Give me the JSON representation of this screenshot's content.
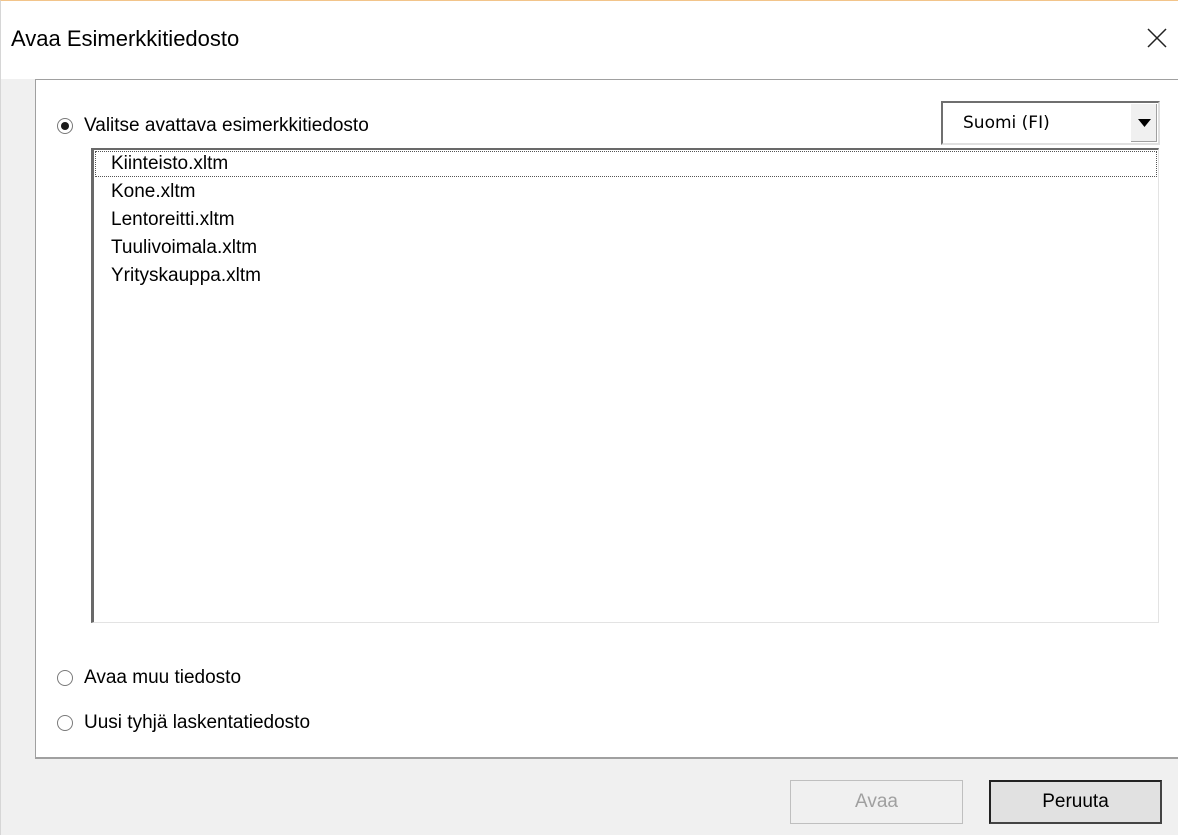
{
  "window": {
    "title": "Avaa Esimerkkitiedosto",
    "close_icon": "close-icon"
  },
  "options": {
    "sample": {
      "label": "Valitse avattava esimerkkitiedosto",
      "selected": true
    },
    "other": {
      "label": "Avaa muu tiedosto",
      "selected": false
    },
    "blank": {
      "label": "Uusi tyhjä laskentatiedosto",
      "selected": false
    }
  },
  "language_select": {
    "value": "Suomi (FI)",
    "arrow_icon": "chevron-down-icon"
  },
  "files": [
    "Kiinteisto.xltm",
    "Kone.xltm",
    "Lentoreitti.xltm",
    "Tuulivoimala.xltm",
    "Yrityskauppa.xltm"
  ],
  "buttons": {
    "open_label": "Avaa",
    "cancel_label": "Peruuta"
  }
}
